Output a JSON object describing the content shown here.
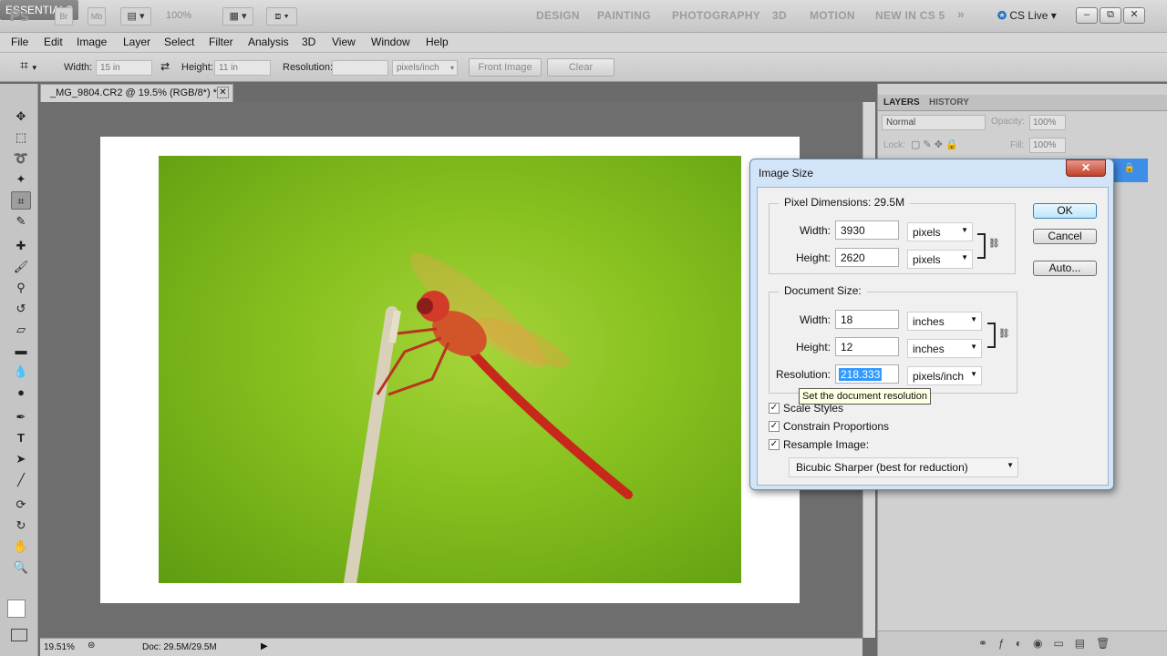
{
  "app": {
    "logo": "Ps",
    "bridge_btn": "Br",
    "minibridge_btn": "Mb",
    "zoom": "100%",
    "workspaces": [
      "ESSENTIALS",
      "DESIGN",
      "PAINTING",
      "PHOTOGRAPHY",
      "3D",
      "MOTION",
      "NEW IN CS 5"
    ],
    "more": "»",
    "cs_live": "CS Live",
    "window_controls": [
      "–",
      "⧉",
      "✕"
    ]
  },
  "menu": [
    "File",
    "Edit",
    "Image",
    "Layer",
    "Select",
    "Filter",
    "Analysis",
    "3D",
    "View",
    "Window",
    "Help"
  ],
  "options": {
    "width_label": "Width:",
    "width_value": "15 in",
    "height_label": "Height:",
    "height_value": "11 in",
    "resolution_label": "Resolution:",
    "resolution_value": "",
    "unit": "pixels/inch",
    "front_image": "Front Image",
    "clear": "Clear"
  },
  "document": {
    "tab_title": "_MG_9804.CR2 @ 19.5% (RGB/8*) *",
    "zoom": "19.51%",
    "doc_info": "Doc: 29.5M/29.5M"
  },
  "panels": {
    "tabs": [
      "LAYERS",
      "HISTORY"
    ],
    "blend_mode": "Normal",
    "opacity_label": "Opacity:",
    "opacity": "100%",
    "lock_label": "Lock:",
    "fill_label": "Fill:",
    "fill": "100%"
  },
  "dialog": {
    "title": "Image Size",
    "close": "✕",
    "pixel_dimensions_label": "Pixel Dimensions:",
    "pixel_dimensions_value": "29.5M",
    "px_width_label": "Width:",
    "px_width": "3930",
    "px_width_unit": "pixels",
    "px_height_label": "Height:",
    "px_height": "2620",
    "px_height_unit": "pixels",
    "document_size_label": "Document Size:",
    "doc_width_label": "Width:",
    "doc_width": "18",
    "doc_width_unit": "inches",
    "doc_height_label": "Height:",
    "doc_height": "12",
    "doc_height_unit": "inches",
    "resolution_label": "Resolution:",
    "resolution": "218.333",
    "resolution_unit": "pixels/inch",
    "ok": "OK",
    "cancel": "Cancel",
    "auto": "Auto...",
    "scale_styles": "Scale Styles",
    "constrain": "Constrain Proportions",
    "resample": "Resample Image:",
    "resample_method": "Bicubic Sharper (best for reduction)",
    "tooltip": "Set the document resolution"
  }
}
